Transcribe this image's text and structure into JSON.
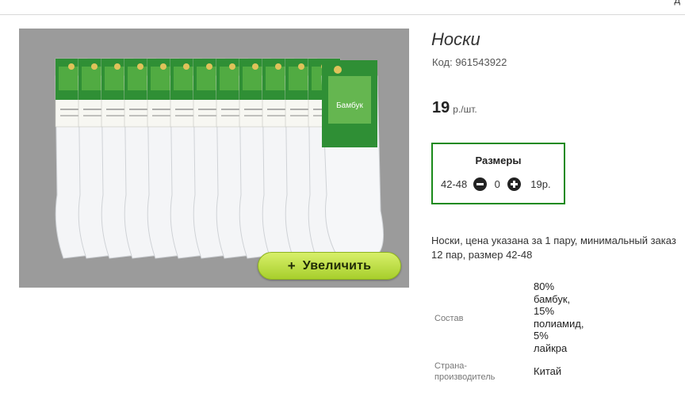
{
  "header": {
    "corner_text": "д"
  },
  "gallery": {
    "zoom_label": "Увеличить",
    "zoom_icon": "plus-icon",
    "sock_label_text": "Бамбук"
  },
  "product": {
    "title": "Носки",
    "code": "Код: 961543922",
    "price_value": "19",
    "price_unit": "р./шт."
  },
  "sizes": {
    "title": "Размеры",
    "rows": [
      {
        "size": "42-48",
        "quantity": "0",
        "price": "19р."
      }
    ]
  },
  "description": "Носки, цена указана за 1 пару, минимальный заказ 12 пар, размер 42-48",
  "specs": [
    {
      "label": "Состав",
      "value": "80%\nбамбук,\n15%\nполиамид,\n5%\nлайкра"
    },
    {
      "label": "Страна-\nпроизводитель",
      "value": "Китай"
    }
  ],
  "colors": {
    "accent_green": "#1a8a1a",
    "zoom_button": "#b9dc3a",
    "photo_background": "#9b9b9b"
  }
}
